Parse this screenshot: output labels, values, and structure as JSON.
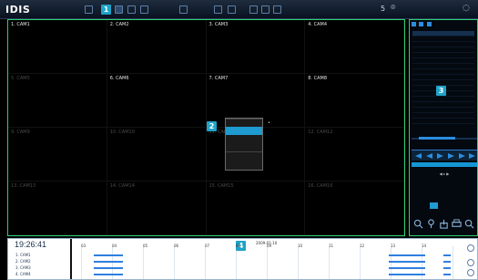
{
  "topbar": {
    "logo": "IDIS",
    "right_indicator": "5",
    "right_icon": "camera-icon"
  },
  "callouts": [
    "1",
    "2",
    "3",
    "4"
  ],
  "grid": {
    "cameras": [
      {
        "label": "1. CAM1",
        "dim": false
      },
      {
        "label": "2. CAM2",
        "dim": false
      },
      {
        "label": "3. CAM3",
        "dim": false
      },
      {
        "label": "4. CAM4",
        "dim": false
      },
      {
        "label": "5. CAM5",
        "dim": true
      },
      {
        "label": "6. CAM6",
        "dim": false
      },
      {
        "label": "7. CAM7",
        "dim": false
      },
      {
        "label": "8. CAM8",
        "dim": false
      },
      {
        "label": "9. CAM9",
        "dim": true
      },
      {
        "label": "10. CAM10",
        "dim": true
      },
      {
        "label": "11. CAM11",
        "dim": true
      },
      {
        "label": "12. CAM12",
        "dim": true
      },
      {
        "label": "13. CAM13",
        "dim": true
      },
      {
        "label": "14. CAM14",
        "dim": true
      },
      {
        "label": "15. CAM15",
        "dim": true
      },
      {
        "label": "16. CAM16",
        "dim": true
      }
    ]
  },
  "context_menu": {
    "items": [
      {
        "label": "",
        "selected": false
      },
      {
        "label": "",
        "selected": true
      },
      {
        "label": "",
        "selected": false
      },
      {
        "label": "",
        "selected": false
      },
      {
        "label": "",
        "selected": false
      }
    ]
  },
  "bottom": {
    "clock": "19:26:41",
    "date": "2009-01-10",
    "hours": [
      "03",
      "04",
      "05",
      "06",
      "07",
      "08",
      "09",
      "10",
      "11",
      "12",
      "13",
      "14"
    ],
    "cameras": [
      "1. CAM1",
      "2. CAM2",
      "3. CAM3",
      "4. CAM4"
    ]
  }
}
